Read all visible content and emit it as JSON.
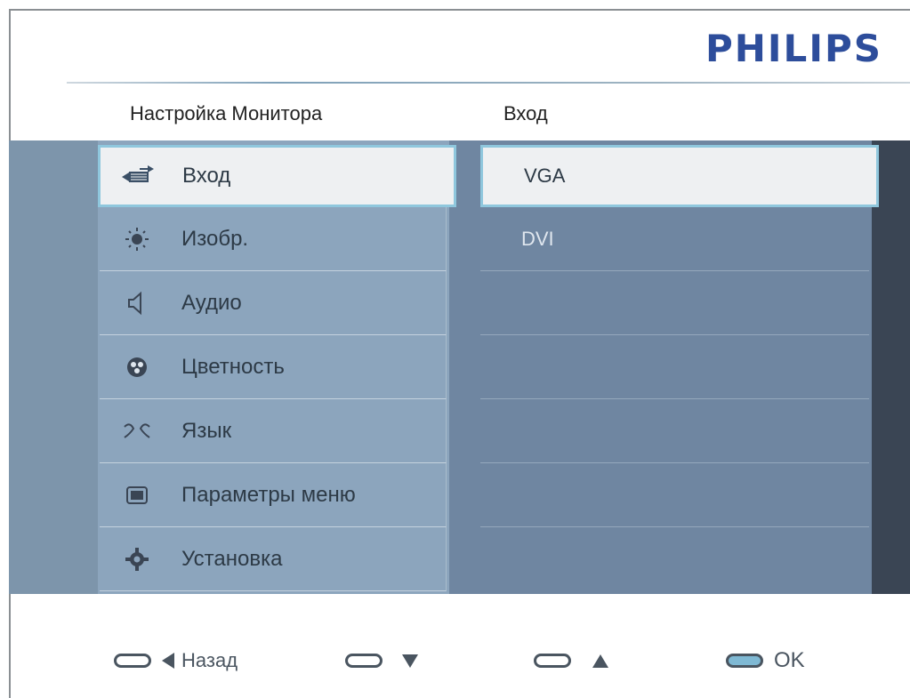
{
  "brand": "PHILIPS",
  "header": {
    "left_title": "Настройка Монитора",
    "right_title": "Вход"
  },
  "menu": {
    "items": [
      {
        "label": "Вход",
        "icon": "input-icon",
        "selected": true
      },
      {
        "label": "Изобр.",
        "icon": "brightness-icon"
      },
      {
        "label": "Аудио",
        "icon": "speaker-icon"
      },
      {
        "label": "Цветность",
        "icon": "color-icon"
      },
      {
        "label": "Язык",
        "icon": "language-icon"
      },
      {
        "label": "Параметры меню",
        "icon": "menu-settings-icon"
      },
      {
        "label": "Установка",
        "icon": "gear-icon"
      }
    ]
  },
  "submenu": {
    "options": [
      {
        "label": "VGA",
        "selected": true
      },
      {
        "label": "DVI"
      }
    ]
  },
  "controls": {
    "back_label": "Назад",
    "ok_label": "OK"
  },
  "colors": {
    "accent": "#8fc7dd",
    "brand": "#2d4d9b"
  }
}
